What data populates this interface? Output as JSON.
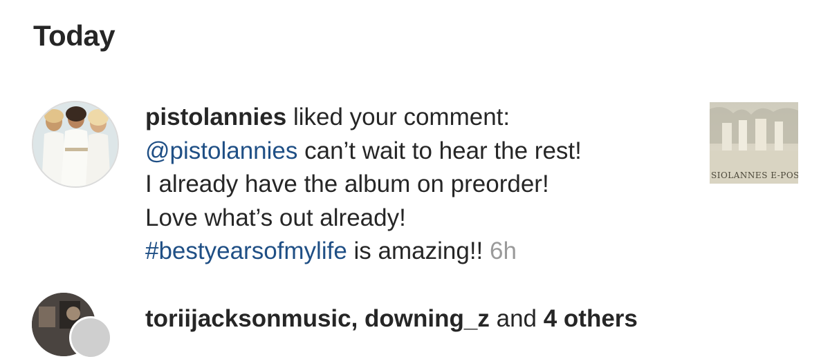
{
  "section": {
    "title": "Today"
  },
  "notifications": [
    {
      "username": "pistolannies",
      "action": " liked your comment:",
      "mention": "@pistolannies",
      "line1_rest": " can’t wait to hear the rest!",
      "line2": "I already have the album on preorder!",
      "line3": "Love what’s out already!",
      "hashtag": "#bestyearsofmylife",
      "line4_rest": " is amazing!! ",
      "time": "6h",
      "avatar_icon": "profile-photo-three-women",
      "thumbnail_icon": "post-thumbnail-pistol-annies"
    },
    {
      "usernames": "toriijacksonmusic, downing_z",
      "connector": " and ",
      "others": "4 others"
    }
  ],
  "colors": {
    "text": "#262626",
    "link": "#1f4f85",
    "timestamp": "#9a9a9a",
    "background": "#ffffff"
  }
}
